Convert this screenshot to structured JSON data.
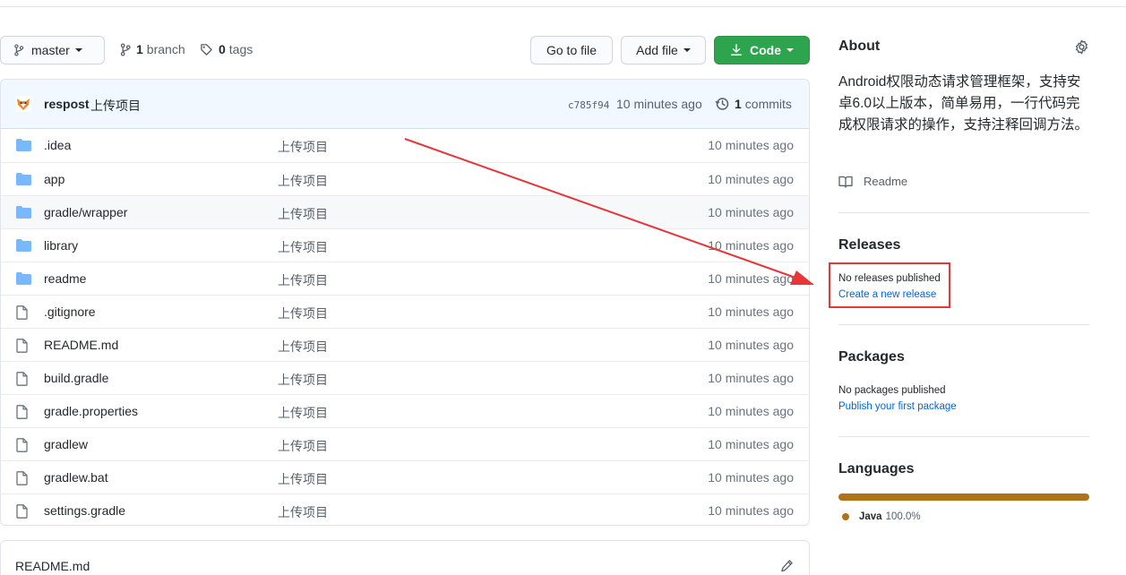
{
  "toolbar": {
    "branch_label": "master",
    "branch_count": "1",
    "branch_word": "branch",
    "tag_count": "0",
    "tag_word": "tags",
    "goto_label": "Go to file",
    "add_label": "Add file",
    "code_label": "Code"
  },
  "commit": {
    "author": "respost",
    "message": "上传项目",
    "sha": "c785f94",
    "time": "10 minutes ago",
    "count": "1",
    "count_word": "commits"
  },
  "files": [
    {
      "name": ".idea",
      "type": "dir",
      "message": "上传项目",
      "age": "10 minutes ago"
    },
    {
      "name": "app",
      "type": "dir",
      "message": "上传项目",
      "age": "10 minutes ago"
    },
    {
      "name": "gradle/wrapper",
      "type": "dir",
      "message": "上传项目",
      "age": "10 minutes ago"
    },
    {
      "name": "library",
      "type": "dir",
      "message": "上传项目",
      "age": "10 minutes ago"
    },
    {
      "name": "readme",
      "type": "dir",
      "message": "上传项目",
      "age": "10 minutes ago"
    },
    {
      "name": ".gitignore",
      "type": "file",
      "message": "上传项目",
      "age": "10 minutes ago"
    },
    {
      "name": "README.md",
      "type": "file",
      "message": "上传项目",
      "age": "10 minutes ago"
    },
    {
      "name": "build.gradle",
      "type": "file",
      "message": "上传项目",
      "age": "10 minutes ago"
    },
    {
      "name": "gradle.properties",
      "type": "file",
      "message": "上传项目",
      "age": "10 minutes ago"
    },
    {
      "name": "gradlew",
      "type": "file",
      "message": "上传项目",
      "age": "10 minutes ago"
    },
    {
      "name": "gradlew.bat",
      "type": "file",
      "message": "上传项目",
      "age": "10 minutes ago"
    },
    {
      "name": "settings.gradle",
      "type": "file",
      "message": "上传项目",
      "age": "10 minutes ago"
    }
  ],
  "readme": {
    "title": "README.md"
  },
  "sidebar": {
    "about_heading": "About",
    "about_description": "Android权限动态请求管理框架，支持安卓6.0以上版本，简单易用，一行代码完成权限请求的操作，支持注释回调方法。",
    "readme_link": "Readme",
    "releases_heading": "Releases",
    "releases_none": "No releases published",
    "releases_create": "Create a new release",
    "packages_heading": "Packages",
    "packages_none": "No packages published",
    "packages_publish": "Publish your first package",
    "languages_heading": "Languages",
    "languages": [
      {
        "name": "Java",
        "percent": "100.0%",
        "color": "#b07219"
      }
    ]
  },
  "colors": {
    "accent_green": "#2ea44f",
    "link_blue": "#0366d6",
    "annotation_red": "#e5373a",
    "folder_blue": "#79b8ff"
  }
}
